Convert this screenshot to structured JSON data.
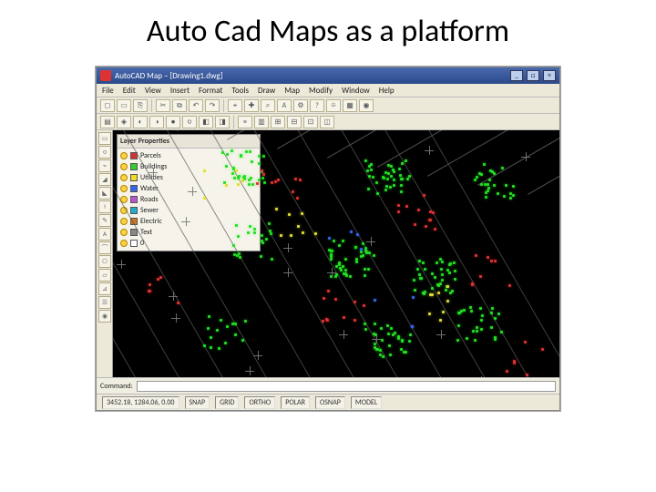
{
  "slide": {
    "title": "Auto Cad Maps as a platform"
  },
  "titlebar": {
    "title": "AutoCAD Map – [Drawing1.dwg]",
    "min": "_",
    "max": "□",
    "close": "×"
  },
  "menu": {
    "items": [
      "File",
      "Edit",
      "View",
      "Insert",
      "Format",
      "Tools",
      "Draw",
      "Map",
      "Modify",
      "Window",
      "Help"
    ]
  },
  "toolbar1": {
    "icons": [
      "◻",
      "▭",
      "⎘",
      "✂",
      "⧉",
      "↶",
      "↷",
      "⌖",
      "✚",
      "⌕",
      "A",
      "⚙",
      "?",
      "⯐",
      "▦",
      "◉"
    ]
  },
  "toolbar2": {
    "icons": [
      "▤",
      "◈",
      "◐",
      "◑",
      "●",
      "○",
      "◧",
      "◨",
      "≡",
      "▥",
      "⊞",
      "⊟",
      "⊡",
      "◫"
    ]
  },
  "palette": {
    "icons": [
      "▭",
      "○",
      "⌁",
      "◢",
      "◣",
      "⟊",
      "✎",
      "A",
      "⌒",
      "⎔",
      "▱",
      "⊿",
      "☰",
      "◉"
    ]
  },
  "layers": {
    "title": "Layer Properties",
    "rows": [
      {
        "color": "#d33333",
        "name": "Parcels"
      },
      {
        "color": "#33cc33",
        "name": "Buildings"
      },
      {
        "color": "#eedd22",
        "name": "Utilities"
      },
      {
        "color": "#3366ee",
        "name": "Water"
      },
      {
        "color": "#bb55cc",
        "name": "Roads"
      },
      {
        "color": "#22aacc",
        "name": "Sewer"
      },
      {
        "color": "#cc7722",
        "name": "Electric"
      },
      {
        "color": "#888888",
        "name": "Text"
      },
      {
        "color": "#ffffff",
        "name": "0"
      }
    ]
  },
  "command": {
    "prompt": "Command:",
    "value": ""
  },
  "status": {
    "coords": "3452.18, 1284.06, 0.00",
    "snap": "SNAP",
    "grid": "GRID",
    "ortho": "ORTHO",
    "polar": "POLAR",
    "osnap": "OSNAP",
    "model": "MODEL"
  },
  "colors": {
    "canvas_bg": "#000000",
    "titlebar_grad_top": "#4a6aae",
    "titlebar_grad_bot": "#2b4a8a"
  }
}
